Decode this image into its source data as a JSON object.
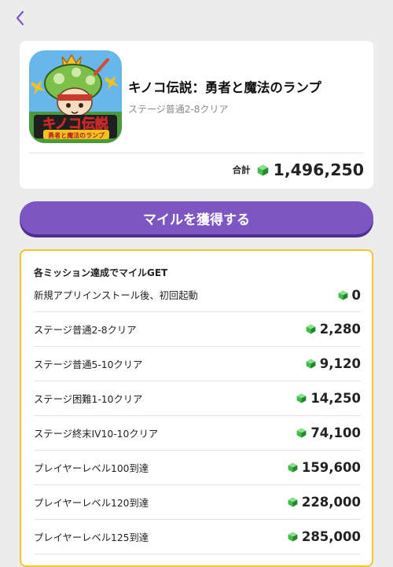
{
  "nav": {
    "back_icon": "chevron-left-icon"
  },
  "app": {
    "icon_text_main": "キノコ伝説",
    "icon_text_sub": "勇者と魔法のランプ",
    "title": "キノコ伝説：勇者と魔法のランプ",
    "current_stage": "ステージ普通2-8クリア",
    "total_label": "合計",
    "total_value": "1,496,250",
    "gem_icon": "green-gem-icon"
  },
  "earn_button_label": "マイルを獲得する",
  "missions": {
    "header": "各ミッション達成でマイルGET",
    "items": [
      {
        "name": "新規アプリインストール後、初回起動",
        "reward": "0"
      },
      {
        "name": "ステージ普通2-8クリア",
        "reward": "2,280"
      },
      {
        "name": "ステージ普通5-10クリア",
        "reward": "9,120"
      },
      {
        "name": "ステージ困難1-10クリア",
        "reward": "14,250"
      },
      {
        "name": "ステージ終末IV10-10クリア",
        "reward": "74,100"
      },
      {
        "name": "プレイヤーレベル100到達",
        "reward": "159,600"
      },
      {
        "name": "プレイヤーレベル120到達",
        "reward": "228,000"
      },
      {
        "name": "プレイヤーレベル125到達",
        "reward": "285,000"
      }
    ]
  },
  "colors": {
    "accent_purple": "#7c56c3",
    "mission_border": "#f2c531",
    "gem_green": "#3fbf4a"
  }
}
